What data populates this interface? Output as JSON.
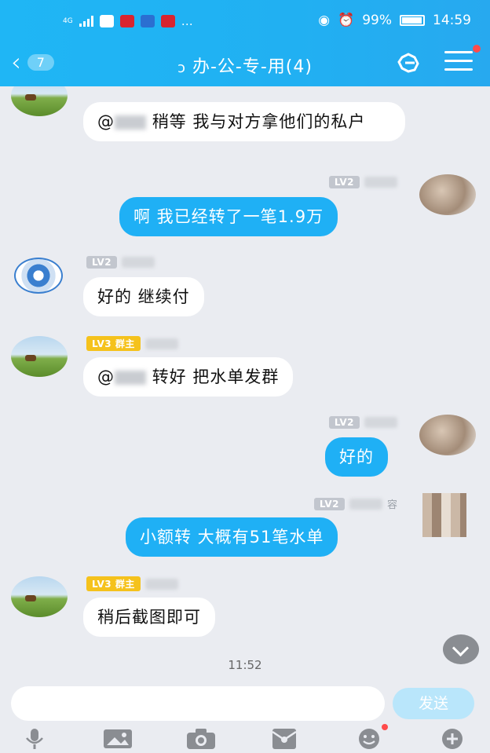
{
  "status_bar": {
    "network": "4G",
    "battery": "99%",
    "time": "14:59",
    "misc": "…"
  },
  "header": {
    "back_count": "7",
    "title": "办-公-专-用(4)",
    "accent": "#21b0f2"
  },
  "messages": [
    {
      "side": "in",
      "text_prefix": "@",
      "text": "稍等 我与对方拿他们的私户"
    },
    {
      "side": "out",
      "level": "LV2",
      "text": "啊 我已经转了一笔1.9万"
    },
    {
      "side": "in",
      "level": "LV2",
      "text": "好的 继续付"
    },
    {
      "side": "in",
      "level": "LV3",
      "role": "群主",
      "text_prefix": "@",
      "text": "转好 把水单发群"
    },
    {
      "side": "out",
      "level": "LV2",
      "text": "好的"
    },
    {
      "side": "out",
      "level": "LV2",
      "name_tail": "容",
      "text": "小额转 大概有51笔水单"
    },
    {
      "side": "in",
      "level": "LV3",
      "role": "群主",
      "text": "稍后截图即可"
    }
  ],
  "timestamp": "11:52",
  "composer": {
    "send_label": "发送"
  },
  "toolbar_icons": [
    "microphone-icon",
    "image-icon",
    "camera-icon",
    "red-packet-icon",
    "emoji-icon",
    "plus-icon"
  ]
}
